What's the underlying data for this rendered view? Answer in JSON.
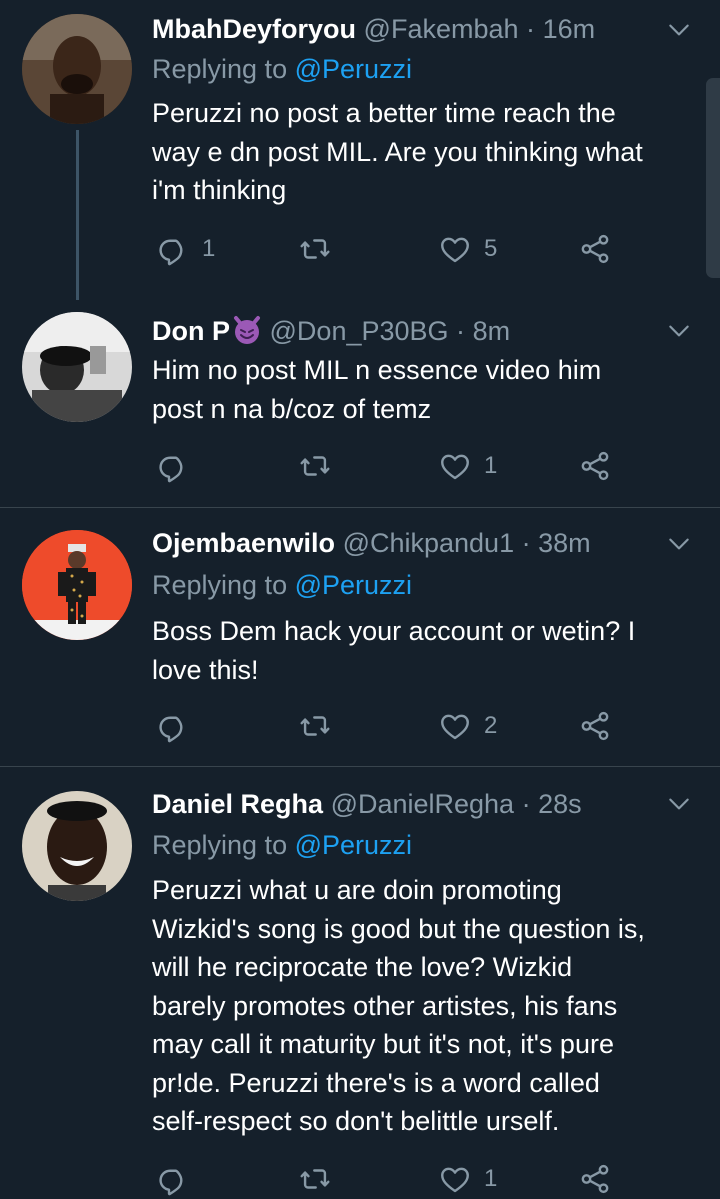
{
  "tweets": [
    {
      "name": "MbahDeyforyou",
      "handle": "@Fakembah",
      "dot": "·",
      "time": "16m",
      "replying_prefix": "Replying to ",
      "replying_to": "@Peruzzi",
      "lines": [
        "Peruzzi no post a better time reach the",
        "way e dn post MIL. Are you thinking what",
        "i'm thinking"
      ],
      "reply_count": "1",
      "retweet_count": "",
      "like_count": "5"
    },
    {
      "name": "Don P",
      "handle": "@Don_P30BG",
      "dot": "·",
      "time": "8m",
      "lines": [
        "Him no post MIL n essence video him",
        "post n na b/coz of temz"
      ],
      "reply_count": "",
      "retweet_count": "",
      "like_count": "1"
    },
    {
      "name": "Ojembaenwilo",
      "handle": "@Chikpandu1",
      "dot": "·",
      "time": "38m",
      "replying_prefix": "Replying to ",
      "replying_to": "@Peruzzi",
      "lines": [
        "Boss Dem hack your account or wetin? I",
        "love this!"
      ],
      "reply_count": "",
      "retweet_count": "",
      "like_count": "2"
    },
    {
      "name": "Daniel Regha",
      "handle": "@DanielRegha",
      "dot": "·",
      "time": "28s",
      "replying_prefix": "Replying to ",
      "replying_to": "@Peruzzi",
      "lines": [
        "Peruzzi what u are doin promoting",
        "Wizkid's song is good but the question is,",
        "will he reciprocate the love? Wizkid",
        "barely promotes other artistes, his fans",
        "may call it maturity but it's not, it's pure",
        "pr!de. Peruzzi there's is a word called",
        "self-respect so don't belittle urself."
      ],
      "reply_count": "",
      "retweet_count": "",
      "like_count": "1"
    }
  ],
  "icons": {
    "reply": "reply-icon",
    "retweet": "retweet-icon",
    "like": "heart-icon",
    "share": "share-icon",
    "caret": "chevron-down-icon",
    "emoji": "smiling-devil-emoji"
  },
  "colors": {
    "background": "#15202b",
    "divider": "#38444d",
    "muted": "#8899a6",
    "link": "#1da1f2",
    "emoji": "#9b59b6"
  }
}
